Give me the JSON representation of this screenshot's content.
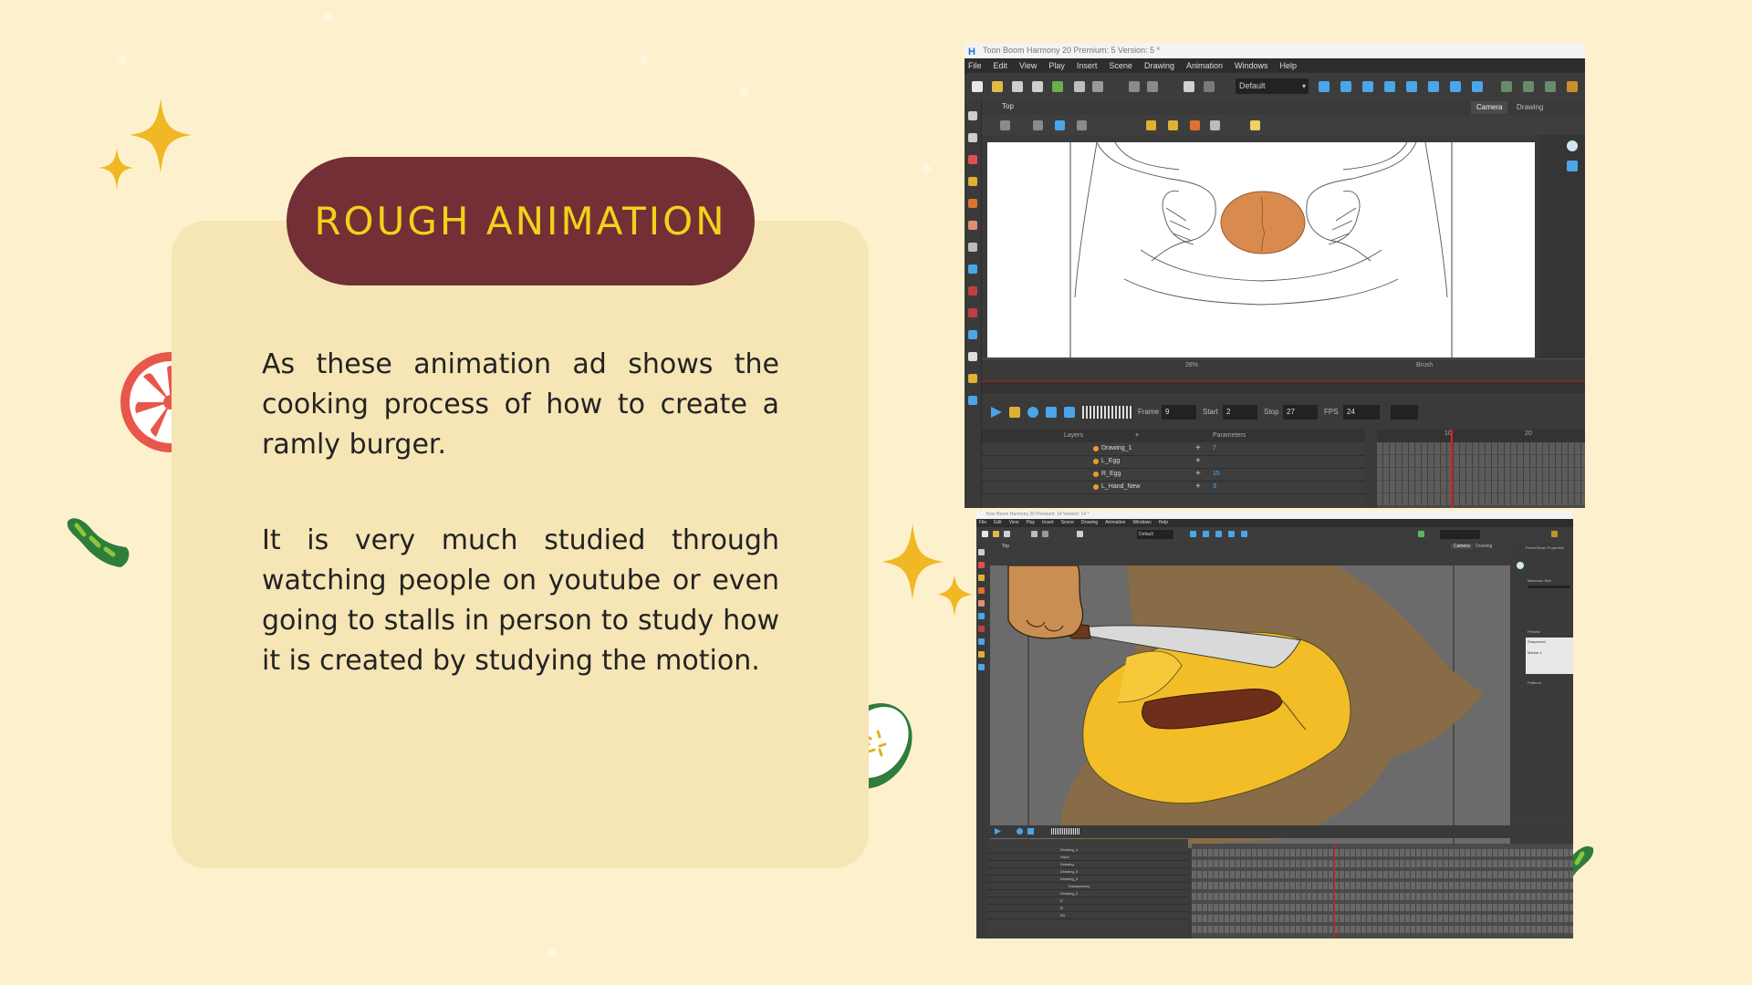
{
  "slide": {
    "title": "ROUGH ANIMATION",
    "paragraph_1": "As these animation ad shows the cooking process of how to create a ramly burger.",
    "paragraph_2": "It is very much studied through watching people on youtube or even going to stalls in person to study how it is created by studying the motion.",
    "colors": {
      "background": "#fdf1cd",
      "card": "#f6e5b5",
      "title_pill": "#722f36",
      "title_text": "#f2d21a",
      "sparkle": "#f0b825",
      "tomato": "#e8574b",
      "cucumber": "#2f7d3a"
    },
    "decorations": [
      "sparkle-icon",
      "tomato-slice-icon",
      "cucumber-peel-icon",
      "cucumber-slice-icon"
    ]
  },
  "screenshot_1": {
    "window_title": "Toon Boom Harmony 20 Premium: 5 Version: 5 *",
    "menu": [
      "File",
      "Edit",
      "View",
      "Play",
      "Insert",
      "Scene",
      "Drawing",
      "Animation",
      "Windows",
      "Help"
    ],
    "workspace_preset": "Default",
    "view_tab": "Top",
    "view_tabs": [
      "Camera",
      "Drawing"
    ],
    "zoom": "28%",
    "tool_status": "Brush",
    "playback": {
      "frame_label": "Frame",
      "frame_value": "9",
      "start_label": "Start",
      "start_value": "2",
      "stop_label": "Stop",
      "stop_value": "27",
      "fps_label": "FPS",
      "fps_value": "24"
    },
    "layers_header": "Layers",
    "parameters_header": "Parameters",
    "layers": [
      {
        "name": "Drawing_1",
        "param": "7"
      },
      {
        "name": "L_Egg",
        "param": ""
      },
      {
        "name": "R_Egg",
        "param": "15"
      },
      {
        "name": "L_Hand_New",
        "param": "3"
      }
    ],
    "timeline_markers": [
      "10",
      "20"
    ]
  },
  "screenshot_2": {
    "window_title": "Toon Boom Harmony 20 Premium: 14 Version: 14 *",
    "menu": [
      "File",
      "Edit",
      "View",
      "Play",
      "Insert",
      "Scene",
      "Drawing",
      "Animation",
      "Windows",
      "Help"
    ],
    "workspace_preset": "Default",
    "view_tab": "Top",
    "view_tabs": [
      "Camera",
      "Drawing"
    ],
    "side_panel_title": "Pencil Brush Properties",
    "side_panel_items": [
      "Maximum Size",
      "Presets",
      "Sharpened",
      "Marker 1",
      "Patterns"
    ],
    "tool_status": "Brush",
    "layers": [
      "Drawing_4",
      "Hand",
      "Drawing",
      "Drawing_5",
      "Drawing_3",
      "Transparency",
      "Drawing_2",
      "E",
      "B",
      "B3"
    ]
  }
}
